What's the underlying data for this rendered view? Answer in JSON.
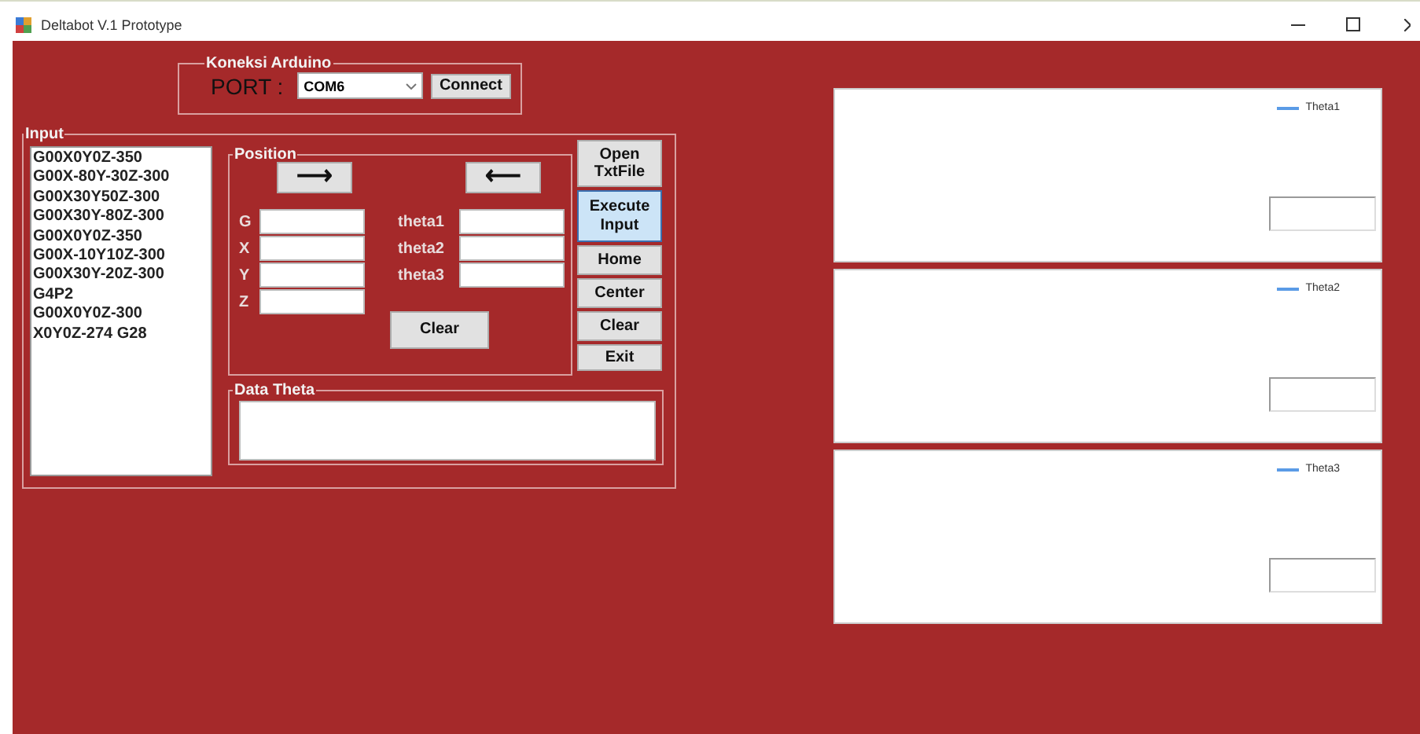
{
  "window": {
    "title": "Deltabot V.1 Prototype"
  },
  "connection": {
    "title": "Koneksi Arduino",
    "port_label": "PORT :",
    "port_value": "COM6",
    "connect_button": "Connect"
  },
  "input": {
    "title": "Input",
    "lines": [
      "G00X0Y0Z-350",
      "G00X-80Y-30Z-300",
      "G00X30Y50Z-300",
      "G00X30Y-80Z-300",
      "G00X0Y0Z-350",
      "G00X-10Y10Z-300",
      "G00X30Y-20Z-300",
      "G4P2",
      "G00X0Y0Z-300",
      "X0Y0Z-274 G28"
    ]
  },
  "position": {
    "title": "Position",
    "arrow_buttons": [
      "⟶",
      "⟵"
    ],
    "fields": [
      {
        "label": "G"
      },
      {
        "label": "X"
      },
      {
        "label": "Y"
      },
      {
        "label": "Z"
      }
    ],
    "theta_fields": [
      {
        "label": "theta1"
      },
      {
        "label": "theta2"
      },
      {
        "label": "theta3"
      }
    ],
    "clear_button": "Clear"
  },
  "side_buttons": [
    {
      "label": "Open TxtFile",
      "focused": false
    },
    {
      "label": "Execute Input",
      "focused": true
    },
    {
      "label": "Home",
      "focused": false
    },
    {
      "label": "Center",
      "focused": false
    },
    {
      "label": "Clear",
      "focused": false
    },
    {
      "label": "Exit",
      "focused": false
    }
  ],
  "data_theta": {
    "title": "Data Theta"
  },
  "charts": [
    {
      "legend": "Theta1"
    },
    {
      "legend": "Theta2"
    },
    {
      "legend": "Theta3"
    }
  ]
}
